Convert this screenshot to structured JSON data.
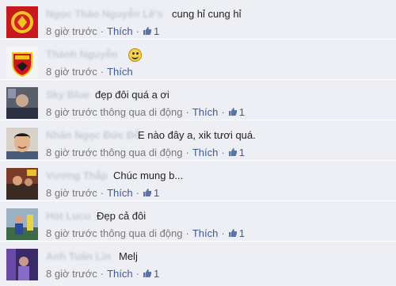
{
  "comments": [
    {
      "name": "Ngọc Thảo Nguyễn Lê's",
      "text": "cung hỉ cung hỉ",
      "time": "8 giờ trước",
      "via": "",
      "like_label": "Thích",
      "likes": "1",
      "avatar": "red-club-crest"
    },
    {
      "name": "Thành Nguyễn",
      "text": "",
      "time": "8 giờ trước",
      "via": "",
      "like_label": "Thích",
      "likes": "",
      "avatar": "manchester-united-crest"
    },
    {
      "name": "Sky Blue",
      "text": "đẹp đôi quá a ơi",
      "time": "8 giờ trước",
      "via": "thông qua di động",
      "like_label": "Thích",
      "likes": "1",
      "avatar": "person-photo-dark"
    },
    {
      "name": "Nhân Ngọc Đức Đỗ",
      "text": "E nào đây a, xik tươi quá.",
      "time": "8 giờ trước",
      "via": "thông qua di động",
      "like_label": "Thích",
      "likes": "1",
      "avatar": "smiling-man-photo"
    },
    {
      "name": "Vương Thắp",
      "text": "Chúc mung b...",
      "time": "8 giờ trước",
      "via": "",
      "like_label": "Thích",
      "likes": "1",
      "avatar": "person-photo-crowd"
    },
    {
      "name": "Hot Lucu",
      "text": "Đẹp cả đôi",
      "time": "8 giờ trước",
      "via": "thông qua di động",
      "like_label": "Thích",
      "likes": "1",
      "avatar": "person-photo-blue"
    },
    {
      "name": "Anh Tuấn Lin",
      "text": "Melj",
      "time": "8 giờ trước",
      "via": "",
      "like_label": "Thích",
      "likes": "1",
      "avatar": "person-photo-purple"
    }
  ],
  "colors": {
    "link": "#3b5998",
    "meta": "#777777",
    "row_bg": "#edeff4"
  }
}
